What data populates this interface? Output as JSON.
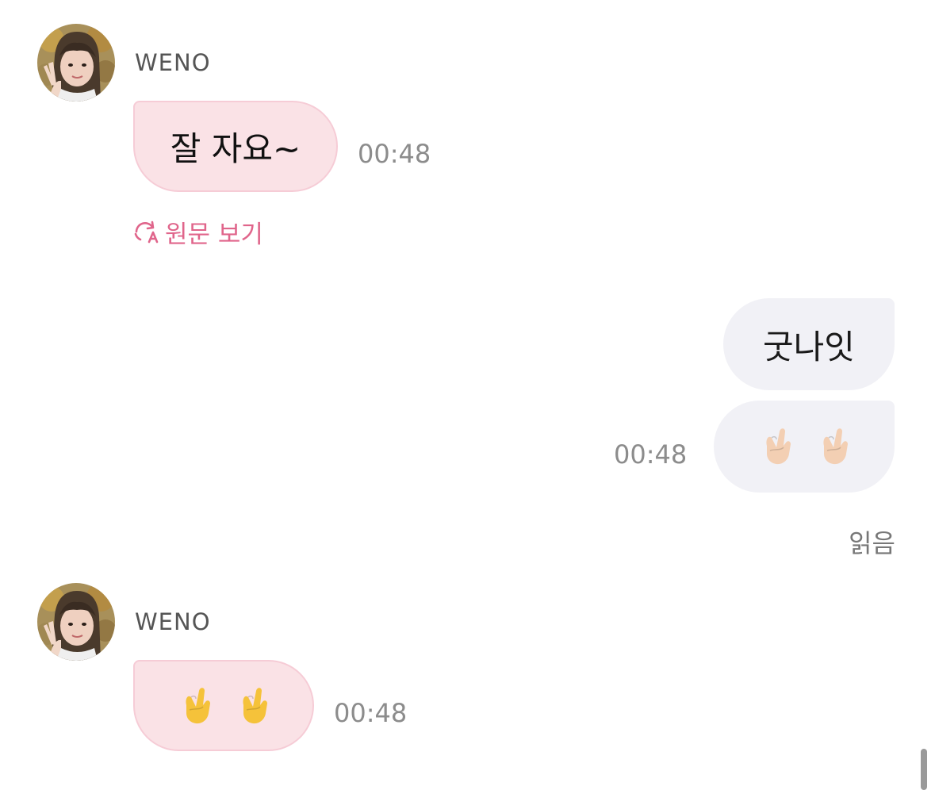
{
  "messages": [
    {
      "sender": "WENO",
      "text": "잘 자요~",
      "time": "00:48",
      "action": "원문 보기"
    },
    {
      "text": "굿나잇"
    },
    {
      "emoji_icon": "finger-heart-icon",
      "emoji_count": 2,
      "time": "00:48",
      "status": "읽음"
    },
    {
      "sender": "WENO",
      "emoji_icon": "finger-heart-icon",
      "emoji_count": 2,
      "time": "00:48"
    }
  ],
  "colors": {
    "incoming_bubble": "#fae2e6",
    "incoming_border": "#f6ccd6",
    "outgoing_bubble": "#f1f1f6",
    "accent": "#e0658b",
    "time_text": "#8c8c8c"
  }
}
